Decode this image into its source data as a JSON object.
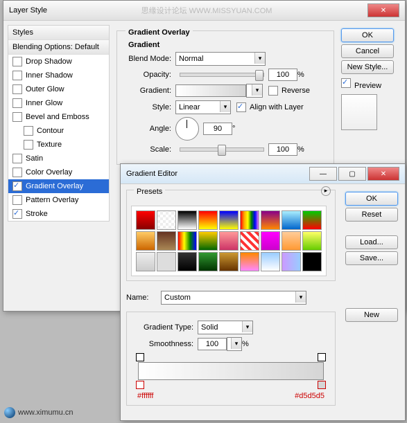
{
  "layerStyle": {
    "title": "Layer Style",
    "watermark": "思缘设计论坛  WWW.MISSYUAN.COM",
    "styles": {
      "header": "Styles",
      "blendHeader": "Blending Options: Default",
      "dropShadow": "Drop Shadow",
      "innerShadow": "Inner Shadow",
      "outerGlow": "Outer Glow",
      "innerGlow": "Inner Glow",
      "bevel": "Bevel and Emboss",
      "contour": "Contour",
      "texture": "Texture",
      "satin": "Satin",
      "colorOverlay": "Color Overlay",
      "gradientOverlay": "Gradient Overlay",
      "patternOverlay": "Pattern Overlay",
      "stroke": "Stroke"
    },
    "section": {
      "title": "Gradient Overlay",
      "sub": "Gradient",
      "blendMode": "Blend Mode:",
      "blendModeVal": "Normal",
      "opacity": "Opacity:",
      "opacityVal": "100",
      "pct": "%",
      "gradient": "Gradient:",
      "reverse": "Reverse",
      "style": "Style:",
      "styleVal": "Linear",
      "align": "Align with Layer",
      "angle": "Angle:",
      "angleVal": "90",
      "deg": "°",
      "scale": "Scale:",
      "scaleVal": "100"
    },
    "btns": {
      "ok": "OK",
      "cancel": "Cancel",
      "newStyle": "New Style...",
      "preview": "Preview"
    }
  },
  "gradEditor": {
    "title": "Gradient Editor",
    "presets": "Presets",
    "name": "Name:",
    "nameVal": "Custom",
    "new": "New",
    "gradType": "Gradient Type:",
    "gradTypeVal": "Solid",
    "smooth": "Smoothness:",
    "smoothVal": "100",
    "pct": "%",
    "btns": {
      "ok": "OK",
      "reset": "Reset",
      "load": "Load...",
      "save": "Save..."
    },
    "stops": {
      "left": "#ffffff",
      "right": "#d5d5d5"
    }
  },
  "footer": "www.ximumu.cn"
}
